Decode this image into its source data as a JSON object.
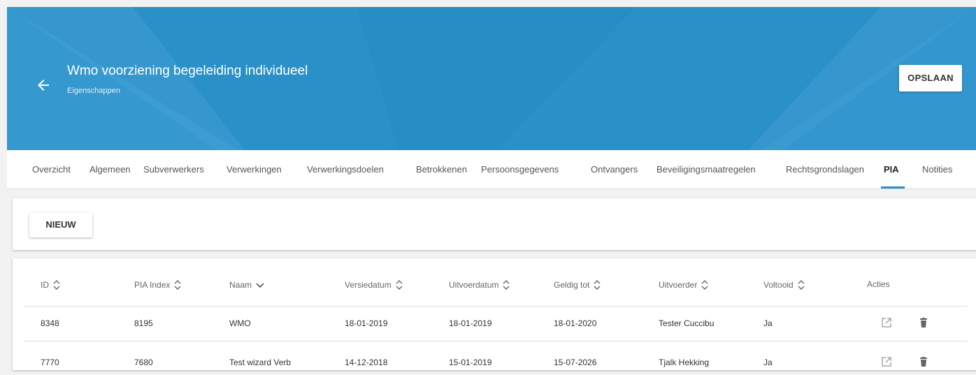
{
  "header": {
    "back_icon": "arrow-left-icon",
    "title": "Wmo voorziening begeleiding individueel",
    "subtitle": "Eigenschappen",
    "save_label": "OPSLAAN",
    "color": "#2a90c8"
  },
  "tabs": [
    {
      "label": "Overzicht"
    },
    {
      "label": "Algemeen"
    },
    {
      "label": "Subverwerkers"
    },
    {
      "label": "Verwerkingen"
    },
    {
      "label": "Verwerkingsdoelen"
    },
    {
      "label": "Betrokkenen"
    },
    {
      "label": "Persoonsgegevens"
    },
    {
      "label": "Ontvangers"
    },
    {
      "label": "Beveiligingsmaatregelen"
    },
    {
      "label": "Rechtsgrondslagen"
    },
    {
      "label": "PIA",
      "active": true
    },
    {
      "label": "Notities"
    }
  ],
  "toolbar": {
    "new_label": "NIEUW"
  },
  "table": {
    "columns": [
      {
        "label": "ID",
        "sort": "both"
      },
      {
        "label": "PIA Index",
        "sort": "both"
      },
      {
        "label": "Naam",
        "sort": "down"
      },
      {
        "label": "Versiedatum",
        "sort": "both"
      },
      {
        "label": "Uitvoerdatum",
        "sort": "both"
      },
      {
        "label": "Geldig tot",
        "sort": "both"
      },
      {
        "label": "Uitvoerder",
        "sort": "both"
      },
      {
        "label": "Voltooid",
        "sort": "both"
      },
      {
        "label": "Acties",
        "sort": "none"
      }
    ],
    "rows": [
      {
        "id": "8348",
        "pia_index": "8195",
        "naam": "WMO",
        "versiedatum": "18-01-2019",
        "uitvoerdatum": "18-01-2019",
        "geldig_tot": "18-01-2020",
        "uitvoerder": "Tester Cuccibu",
        "voltooid": "Ja"
      },
      {
        "id": "7770",
        "pia_index": "7680",
        "naam": "Test wizard Verb",
        "versiedatum": "14-12-2018",
        "uitvoerdatum": "15-01-2019",
        "geldig_tot": "15-07-2026",
        "uitvoerder": "Tjalk Hekking",
        "voltooid": "Ja"
      }
    ],
    "action_icons": [
      "open-external-icon",
      "trash-icon"
    ]
  }
}
